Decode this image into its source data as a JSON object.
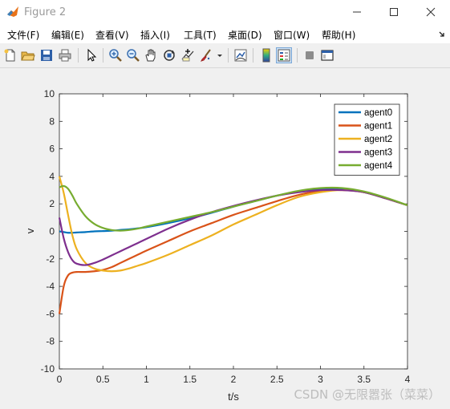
{
  "window": {
    "title": "Figure 2"
  },
  "menu": {
    "items": [
      "文件(F)",
      "编辑(E)",
      "查看(V)",
      "插入(I)",
      "工具(T)",
      "桌面(D)",
      "窗口(W)",
      "帮助(H)"
    ]
  },
  "toolbar": {
    "icons": [
      "new-figure-icon",
      "open-file-icon",
      "save-icon",
      "print-icon",
      "pointer-icon",
      "zoom-in-icon",
      "zoom-out-icon",
      "pan-hand-icon",
      "rotate-3d-icon",
      "data-cursor-icon",
      "brush-icon",
      "brush-dropdown-icon",
      "link-plot-icon",
      "colorbar-icon",
      "legend-icon",
      "hide-plot-tools-icon",
      "show-plot-tools-icon"
    ],
    "active": "legend-icon"
  },
  "colors": {
    "agent0": "#0072BD",
    "agent1": "#D95319",
    "agent2": "#EDB120",
    "agent3": "#7E2F8E",
    "agent4": "#77AC30"
  },
  "chart_data": {
    "type": "line",
    "xlabel": "t/s",
    "ylabel": "v",
    "xlim": [
      0,
      4
    ],
    "ylim": [
      -10,
      10
    ],
    "xticks": [
      0,
      0.5,
      1,
      1.5,
      2,
      2.5,
      3,
      3.5,
      4
    ],
    "xtick_labels": [
      "0",
      "0.5",
      "1",
      "1.5",
      "2",
      "2.5",
      "3",
      "3.5",
      "4"
    ],
    "yticks": [
      -10,
      -8,
      -6,
      -4,
      -2,
      0,
      2,
      4,
      6,
      8,
      10
    ],
    "ytick_labels": [
      "-10",
      "-8",
      "-6",
      "-4",
      "-2",
      "0",
      "2",
      "4",
      "6",
      "8",
      "10"
    ],
    "grid": false,
    "legend_position": "top-right",
    "x": [
      0,
      0.05,
      0.1,
      0.15,
      0.2,
      0.3,
      0.4,
      0.5,
      0.6,
      0.7,
      0.8,
      0.9,
      1.0,
      1.25,
      1.5,
      1.75,
      2.0,
      2.25,
      2.5,
      2.75,
      3.0,
      3.25,
      3.5,
      3.75,
      4.0
    ],
    "series": [
      {
        "name": "agent0",
        "values": [
          0.0,
          -0.05,
          -0.1,
          -0.1,
          -0.08,
          -0.05,
          0.0,
          0.02,
          0.05,
          0.1,
          0.15,
          0.22,
          0.3,
          0.6,
          0.95,
          1.35,
          1.8,
          2.2,
          2.6,
          2.9,
          3.1,
          3.1,
          2.85,
          2.4,
          1.9
        ]
      },
      {
        "name": "agent1",
        "values": [
          -6.0,
          -4.0,
          -3.2,
          -3.0,
          -2.95,
          -2.95,
          -2.9,
          -2.8,
          -2.6,
          -2.3,
          -2.0,
          -1.7,
          -1.4,
          -0.7,
          0.0,
          0.6,
          1.2,
          1.7,
          2.2,
          2.65,
          2.95,
          3.0,
          2.85,
          2.4,
          1.9
        ]
      },
      {
        "name": "agent2",
        "values": [
          4.0,
          2.8,
          1.2,
          -0.3,
          -1.3,
          -2.3,
          -2.7,
          -2.85,
          -2.9,
          -2.85,
          -2.7,
          -2.5,
          -2.3,
          -1.7,
          -1.0,
          -0.3,
          0.5,
          1.2,
          1.9,
          2.5,
          2.85,
          3.0,
          2.85,
          2.4,
          1.9
        ]
      },
      {
        "name": "agent3",
        "values": [
          1.0,
          -0.5,
          -1.5,
          -2.1,
          -2.35,
          -2.45,
          -2.3,
          -2.05,
          -1.75,
          -1.45,
          -1.15,
          -0.85,
          -0.55,
          0.2,
          0.85,
          1.4,
          1.85,
          2.25,
          2.6,
          2.85,
          3.0,
          3.0,
          2.85,
          2.4,
          1.9
        ]
      },
      {
        "name": "agent4",
        "values": [
          3.2,
          3.3,
          3.1,
          2.6,
          2.0,
          1.1,
          0.55,
          0.25,
          0.1,
          0.05,
          0.1,
          0.2,
          0.35,
          0.7,
          1.05,
          1.4,
          1.8,
          2.2,
          2.6,
          2.95,
          3.15,
          3.15,
          2.9,
          2.45,
          1.9
        ]
      }
    ]
  },
  "watermark": "CSDN @无限嚣张（菜菜）"
}
